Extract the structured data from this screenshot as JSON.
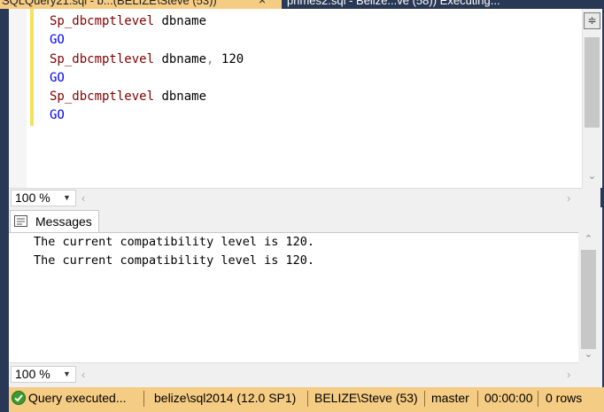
{
  "tabs": [
    {
      "label": "SQLQuery21.sql - b...(BELIZE\\Steve (53))",
      "active": true,
      "close": "×"
    },
    {
      "label": "primes2.sql - Belize...ve (58)) Executing...",
      "active": false
    }
  ],
  "editor": {
    "lines": [
      {
        "fn": "Sp_dbcmptlevel",
        "id": " dbname",
        "sep": "",
        "num": ""
      },
      {
        "kw": "GO"
      },
      {
        "fn": "Sp_dbcmptlevel",
        "id": " dbname",
        "sep": ",",
        "num": " 120"
      },
      {
        "kw": "GO"
      },
      {
        "fn": "Sp_dbcmptlevel",
        "id": " dbname",
        "sep": "",
        "num": ""
      },
      {
        "kw": "GO"
      }
    ],
    "zoom": "100 %"
  },
  "results": {
    "tab_label": "Messages",
    "messages": [
      "The current compatibility level is 120.",
      "The current compatibility level is 120."
    ],
    "zoom": "100 %"
  },
  "status": {
    "state": "Query executed...",
    "server": "belize\\sql2014 (12.0 SP1)",
    "user": "BELIZE\\Steve (53)",
    "database": "master",
    "elapsed": "00:00:00",
    "rows": "0 rows"
  },
  "colors": {
    "tab_active": "#f5cc84",
    "status_bar": "#f5cc84",
    "frame": "#293955",
    "keyword": "#0000ff",
    "function": "#800000"
  }
}
